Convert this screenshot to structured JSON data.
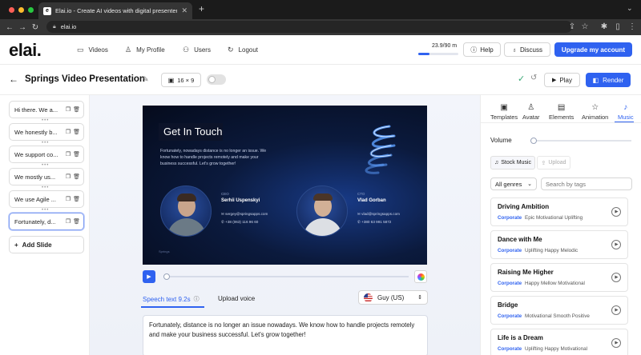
{
  "browser": {
    "tab_title": "Elai.io - Create AI videos with digital presenter from text",
    "tab_favicon": "e",
    "tab_close": "✕",
    "url": "elai.io"
  },
  "app": {
    "logo": "elai.",
    "nav": [
      {
        "label": "Videos",
        "icon": "video-icon",
        "glyph": "▭"
      },
      {
        "label": "My Profile",
        "icon": "user-icon",
        "glyph": "♙"
      },
      {
        "label": "Users",
        "icon": "users-icon",
        "glyph": "⚇"
      },
      {
        "label": "Logout",
        "icon": "logout-icon",
        "glyph": "↻"
      }
    ],
    "usage": "23.9/90 m",
    "usage_fraction": 0.27,
    "help": "Help",
    "discuss": "Discuss",
    "upgrade": "Upgrade my account"
  },
  "project": {
    "title": "Springs Video Presentation",
    "aspect": "16 × 9",
    "play": "Play",
    "render": "Render"
  },
  "slides": [
    {
      "label": "Hi there. We a..."
    },
    {
      "label": "We honestly b..."
    },
    {
      "label": "We support co..."
    },
    {
      "label": "We mostly us..."
    },
    {
      "label": "We use Agile ..."
    },
    {
      "label": "Fortunately, d..."
    }
  ],
  "add_slide": "Add Slide",
  "video": {
    "heading": "Get In Touch",
    "body": "Fortunately, nowadays distance is no longer an issue. We know how to handle projects remotely and make your business successful. Let's grow together!",
    "person1": {
      "role": "CEO",
      "name": "Serhii Uspenskyi",
      "email": "sergey@springsapps.com",
      "phone": "+38 (063) 116 96 60"
    },
    "person2": {
      "role": "CTO",
      "name": "Vlad Gorban",
      "email": "vlad@springsapps.com",
      "phone": "+380 63 991 5872"
    },
    "footer": "Springs",
    "progress_fraction": 0.0
  },
  "speech": {
    "tab_speech": "Speech text 9.2s",
    "tab_upload": "Upload voice",
    "voice": "Guy (US)",
    "text": "Fortunately,  distance is no longer an issue nowadays. We know how to handle projects remotely and make your business successful. Let's grow together!"
  },
  "right_panel": {
    "tabs": [
      {
        "label": "Templates",
        "icon": "templates-icon",
        "glyph": "▣"
      },
      {
        "label": "Avatar",
        "icon": "avatar-icon",
        "glyph": "♙"
      },
      {
        "label": "Elements",
        "icon": "elements-icon",
        "glyph": "▤"
      },
      {
        "label": "Animation",
        "icon": "animation-icon",
        "glyph": "☆"
      },
      {
        "label": "Music",
        "icon": "music-icon",
        "glyph": "♪"
      }
    ],
    "active_tab": "Music",
    "volume_label": "Volume",
    "volume_fraction": 0.0,
    "subtabs": [
      "Stock Music",
      "Upload"
    ],
    "genre": "All genres",
    "search_placeholder": "Search by tags",
    "tracks": [
      {
        "name": "Driving Ambition",
        "category": "Corporate",
        "tags": "Epic Motivational Uplifting"
      },
      {
        "name": "Dance with Me",
        "category": "Corporate",
        "tags": "Uplifting Happy Melodic"
      },
      {
        "name": "Raising Me Higher",
        "category": "Corporate",
        "tags": "Happy Mellow Motivational"
      },
      {
        "name": "Bridge",
        "category": "Corporate",
        "tags": "Motivational Smooth Positive"
      },
      {
        "name": "Life is a Dream",
        "category": "Corporate",
        "tags": "Uplifting Happy Motivational"
      }
    ]
  },
  "colors": {
    "accent": "#2f62f0",
    "check": "#3aa876"
  }
}
